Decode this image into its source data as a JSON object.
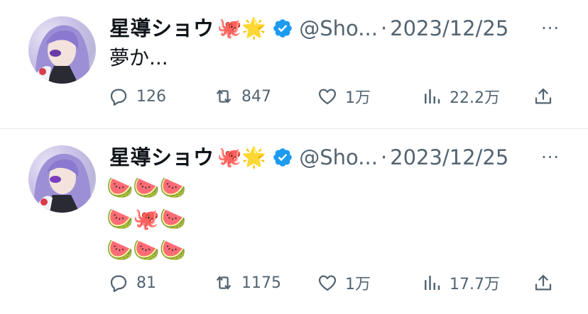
{
  "tweets": [
    {
      "author_name": "星導ショウ",
      "name_emojis": "🐙🌟",
      "handle": "@Sho...",
      "separator": "·",
      "date": "2023/12/25",
      "more": "···",
      "text": "夢か...",
      "emoji_grid": [],
      "replies": "126",
      "retweets": "847",
      "likes": "1万",
      "views": "22.2万"
    },
    {
      "author_name": "星導ショウ",
      "name_emojis": "🐙🌟",
      "handle": "@Sho...",
      "separator": "·",
      "date": "2023/12/25",
      "more": "···",
      "text": "",
      "emoji_grid": [
        "🍉🍉🍉",
        "🍉🐙🍉",
        "🍉🍉🍉"
      ],
      "replies": "81",
      "retweets": "1175",
      "likes": "1万",
      "views": "17.7万"
    }
  ],
  "icons": {
    "reply": "reply-icon",
    "retweet": "retweet-icon",
    "like": "heart-icon",
    "views": "views-icon",
    "share": "share-icon",
    "verified": "verified-badge-icon"
  },
  "colors": {
    "text_primary": "#0f1419",
    "text_secondary": "#536471",
    "verified_blue": "#1d9bf0",
    "divider": "#e6e9eb"
  }
}
